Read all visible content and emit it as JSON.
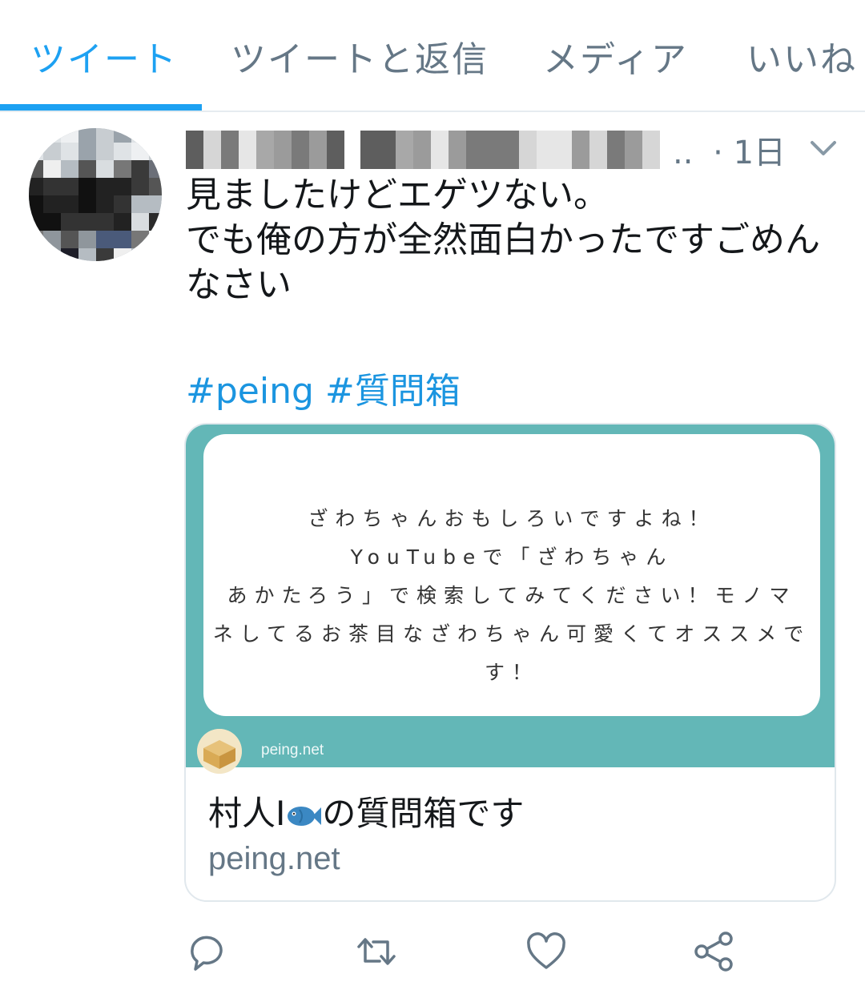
{
  "tabs": [
    {
      "label": "ツイート",
      "active": true
    },
    {
      "label": "ツイートと返信",
      "active": false
    },
    {
      "label": "メディア",
      "active": false
    },
    {
      "label": "いいね",
      "active": false
    }
  ],
  "tweet": {
    "name_truncation": "..",
    "time": "· 1日",
    "text_lines": [
      "見ましたけどエゲツない。",
      "でも俺の方が全然面白かったですごめん",
      "なさい"
    ],
    "hashtags": "#peing #質問箱"
  },
  "card": {
    "image_text_lines": [
      "ざわちゃんおもしろいですよね！",
      "YouTubeで「ざわちゃん",
      "あかたろう」で検索してみてください！モノマ",
      "ネしてるお茶目なざわちゃん可愛くてオススメで",
      "す！"
    ],
    "image_domain": "peing.net",
    "title_before": "村人I",
    "title_after": "の質問箱です",
    "url": "peing.net"
  },
  "actions": [
    "reply-icon",
    "retweet-icon",
    "like-icon",
    "share-icon"
  ],
  "colors": {
    "accent": "#1da1f2",
    "hashtag": "#1b95e0",
    "card_bg": "#63b7b7",
    "muted": "#657786"
  }
}
